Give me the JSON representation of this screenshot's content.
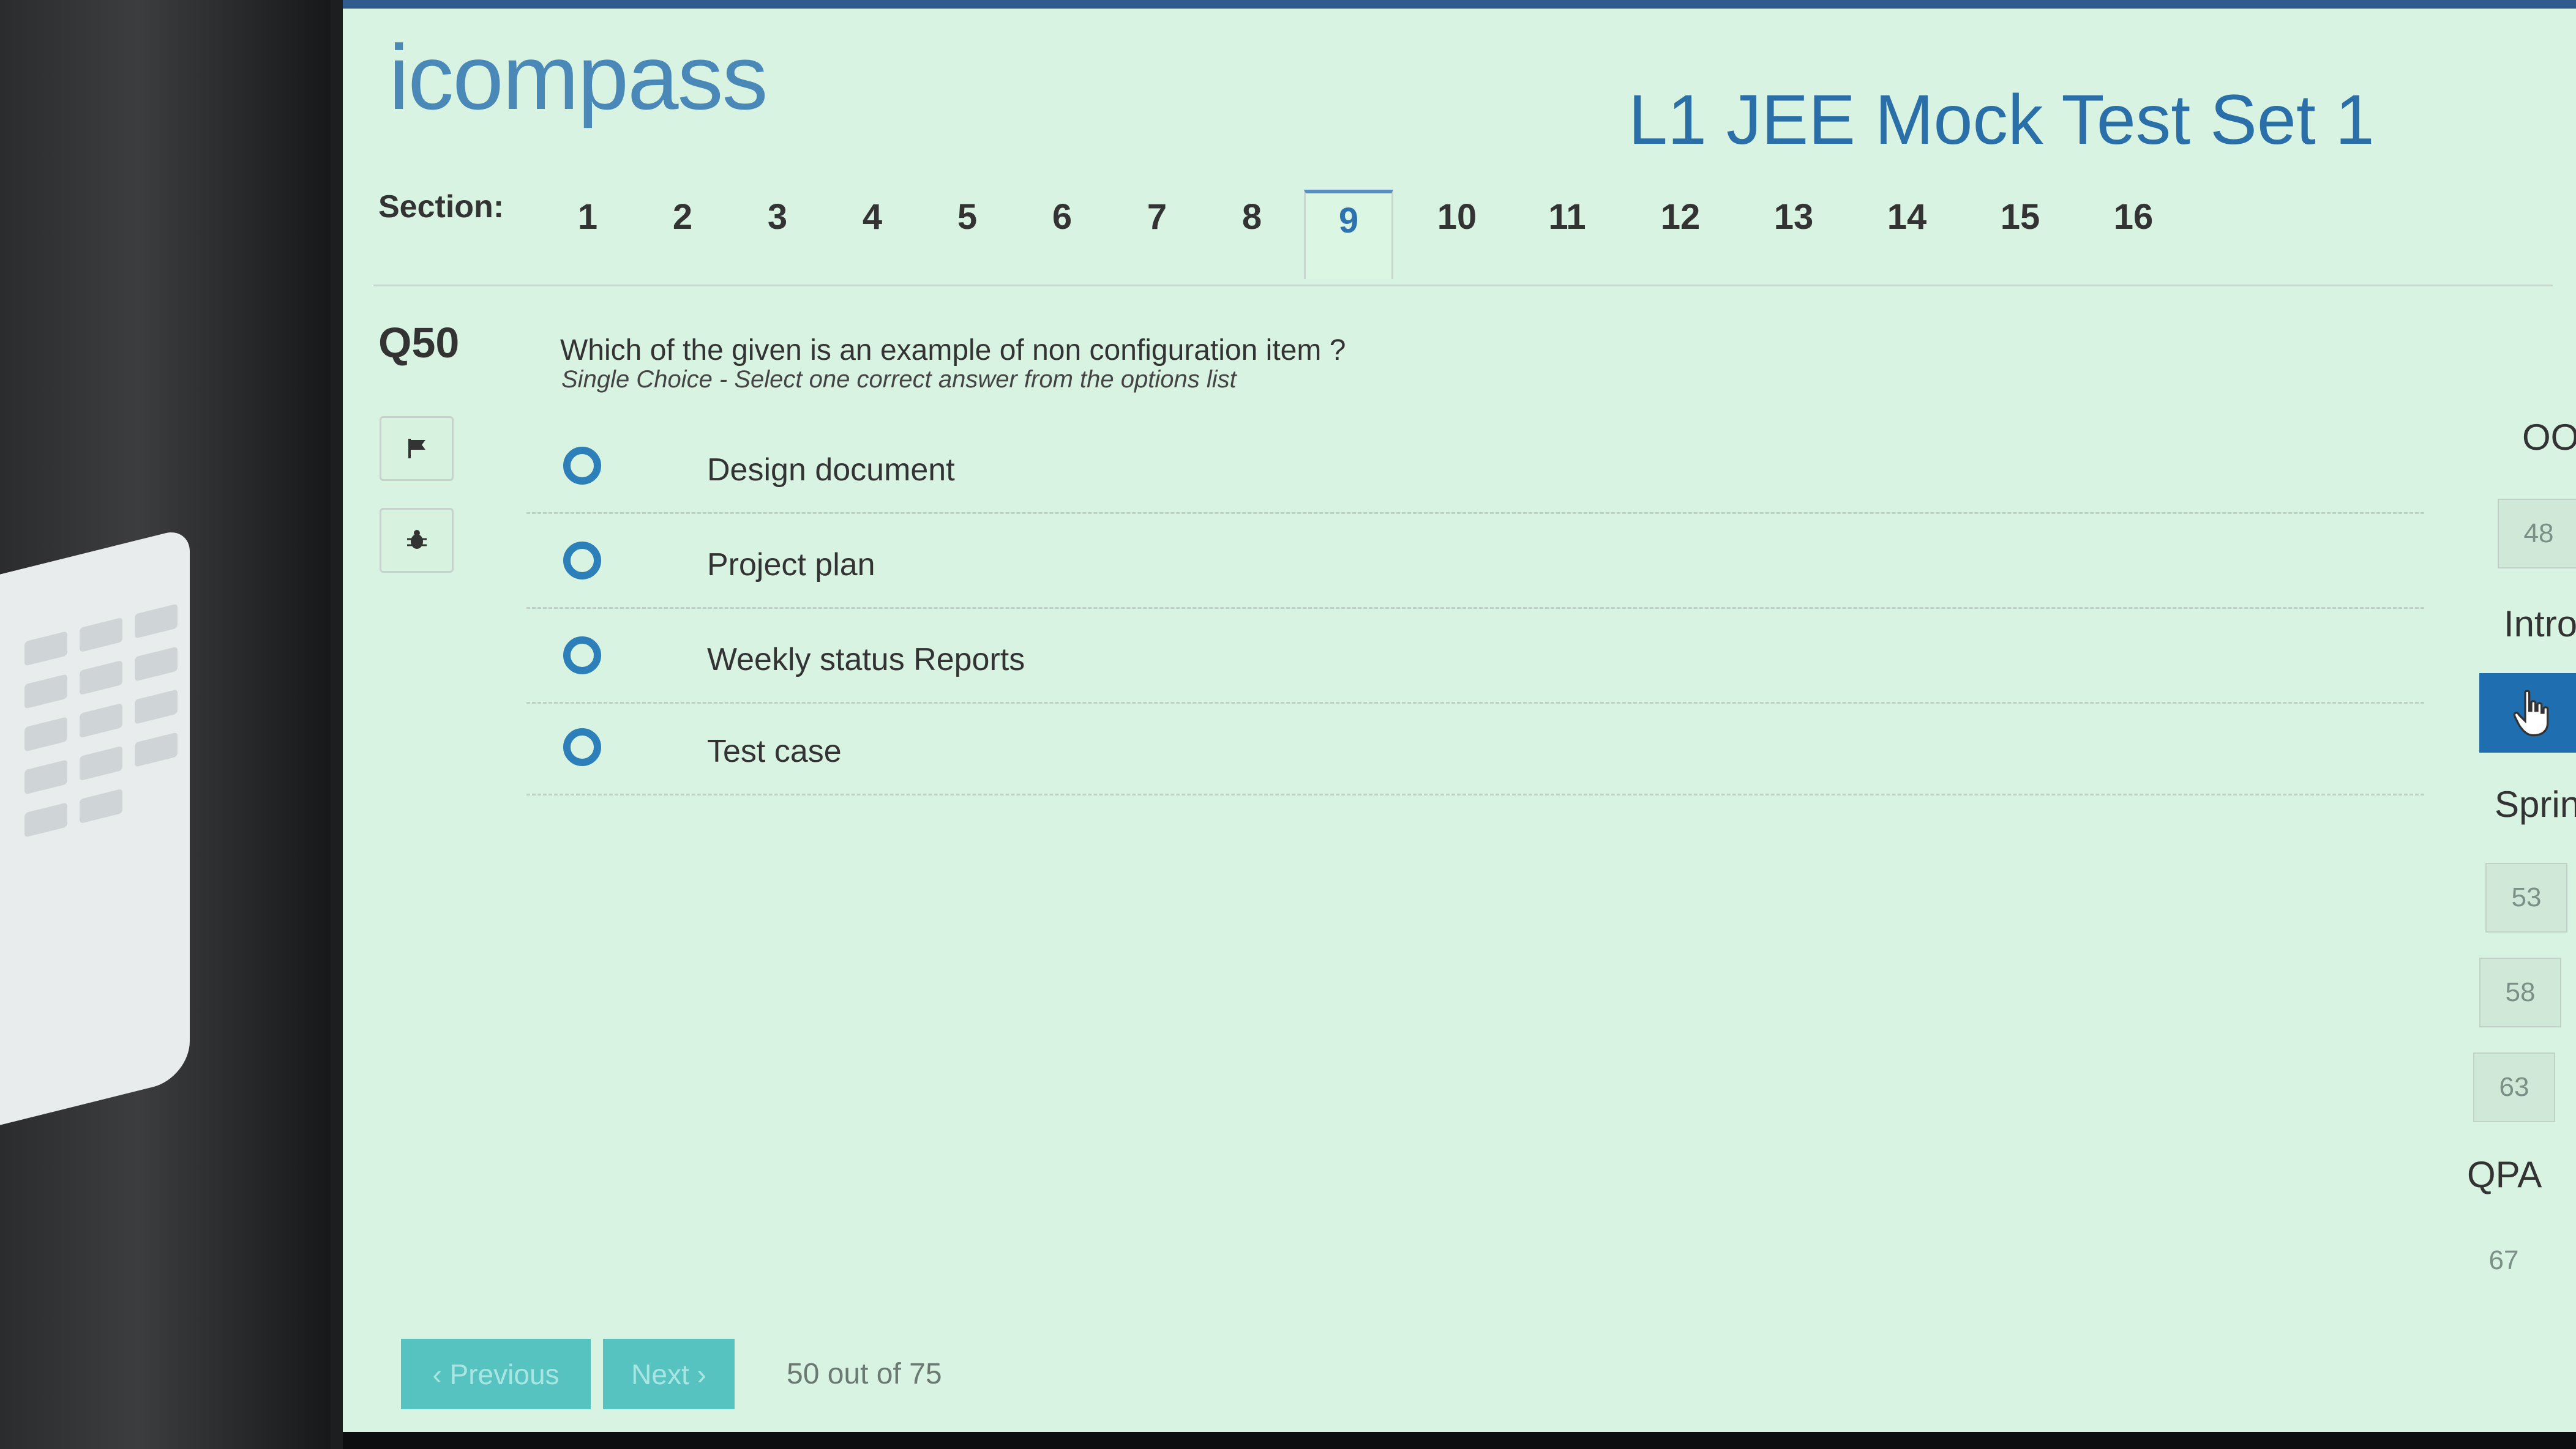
{
  "header": {
    "logo_text": "icompass",
    "title": "L1 JEE Mock Test Set 1"
  },
  "sections": {
    "label": "Section:",
    "tabs": [
      "1",
      "2",
      "3",
      "4",
      "5",
      "6",
      "7",
      "8",
      "9",
      "10",
      "11",
      "12",
      "13",
      "14",
      "15",
      "16"
    ],
    "active": "9"
  },
  "question": {
    "number": "Q50",
    "text": "Which of the given is an example of non configuration item ?",
    "hint": "Single Choice - Select one correct answer from the options list",
    "options": [
      "Design document",
      "Project plan",
      "Weekly status Reports",
      "Test case"
    ]
  },
  "side_tools": {
    "flag_icon": "flag-icon",
    "bug_icon": "bug-icon"
  },
  "right_panel": {
    "items": [
      "OO",
      "48",
      "Intro",
      "Sprin",
      "53",
      "58",
      "63",
      "QPA",
      "67"
    ],
    "active_icon": "hand-pointer-icon"
  },
  "footer": {
    "previous_label": "‹ Previous",
    "next_label": "Next ›",
    "progress_text": "50 out of 75"
  },
  "colors": {
    "background": "#d8f3e1",
    "accent": "#2c7fb8",
    "title": "#2a6fa8",
    "button": "#56c3c0"
  }
}
